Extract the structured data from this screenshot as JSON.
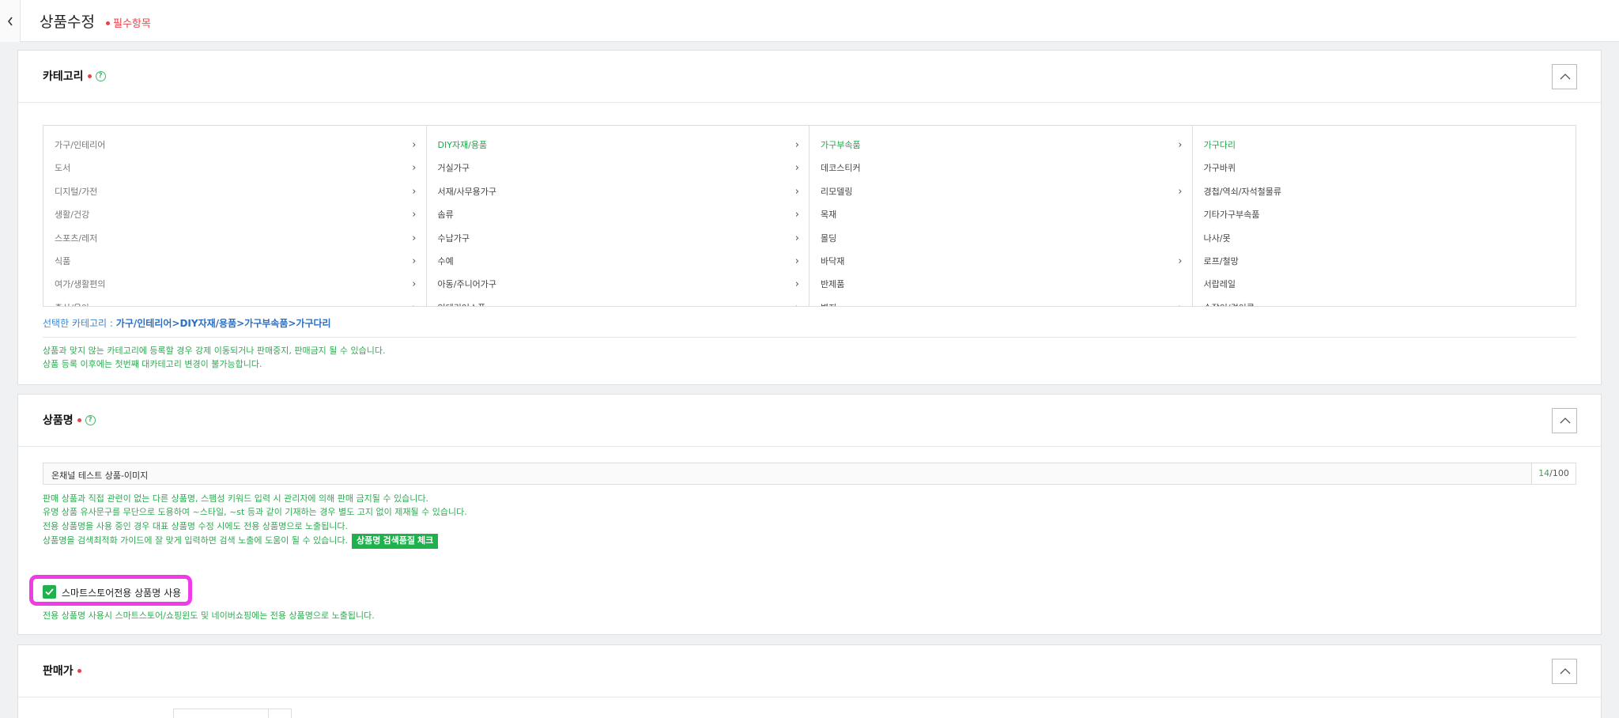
{
  "header": {
    "title": "상품수정",
    "required_note": "필수항목"
  },
  "category": {
    "title": "카테고리",
    "columns": [
      [
        {
          "label": "가구/인테리어",
          "arrow": true
        },
        {
          "label": "도서",
          "arrow": true
        },
        {
          "label": "디지털/가전",
          "arrow": true
        },
        {
          "label": "생활/건강",
          "arrow": true
        },
        {
          "label": "스포츠/레저",
          "arrow": true
        },
        {
          "label": "식품",
          "arrow": true
        },
        {
          "label": "여가/생활편의",
          "arrow": true
        },
        {
          "label": "출산/육아",
          "arrow": true
        }
      ],
      [
        {
          "label": "DIY자재/용품",
          "arrow": true,
          "selected": true
        },
        {
          "label": "거실가구",
          "arrow": true
        },
        {
          "label": "서재/사무용가구",
          "arrow": true
        },
        {
          "label": "솜류",
          "arrow": true
        },
        {
          "label": "수납가구",
          "arrow": true
        },
        {
          "label": "수예",
          "arrow": true
        },
        {
          "label": "아동/주니어가구",
          "arrow": true
        },
        {
          "label": "인테리어소품",
          "arrow": true
        }
      ],
      [
        {
          "label": "가구부속품",
          "arrow": true,
          "selected": true
        },
        {
          "label": "데코스티커",
          "arrow": false
        },
        {
          "label": "리모델링",
          "arrow": true
        },
        {
          "label": "목재",
          "arrow": false
        },
        {
          "label": "몰딩",
          "arrow": false
        },
        {
          "label": "바닥재",
          "arrow": true
        },
        {
          "label": "반제품",
          "arrow": false
        },
        {
          "label": "벽지",
          "arrow": true
        }
      ],
      [
        {
          "label": "가구다리",
          "arrow": false,
          "selected": true
        },
        {
          "label": "가구바퀴",
          "arrow": false
        },
        {
          "label": "경첩/역쇠/자석철물류",
          "arrow": false
        },
        {
          "label": "기타가구부속품",
          "arrow": false
        },
        {
          "label": "나사/못",
          "arrow": false
        },
        {
          "label": "로프/철망",
          "arrow": false
        },
        {
          "label": "서랍레일",
          "arrow": false
        },
        {
          "label": "손잡이/걸이류",
          "arrow": false
        }
      ]
    ],
    "selected_label": "선택한 카테고리 :",
    "selected_path": "가구/인테리어>DIY자재/용품>가구부속품>가구다리",
    "notices": [
      "상품과 맞지 않는 카테고리에 등록할 경우 강제 이동되거나 판매중지, 판매금지 될 수 있습니다.",
      "상품 등록 이후에는 첫번째 대카테고리 변경이 불가능합니다."
    ]
  },
  "product_name": {
    "title": "상품명",
    "value": "온채널 테스트 상품-이미지",
    "count_current": "14",
    "count_max": "/100",
    "notices": [
      "판매 상품과 직접 관련이 없는 다른 상품명, 스팸성 키워드 입력 시 관리자에 의해 판매 금지될 수 있습니다.",
      "유명 상품 유사문구를 무단으로 도용하여 ~스타일, ~st 등과 같이 기재하는 경우 별도 고지 없이 제재될 수 있습니다.",
      "전용 상품명을 사용 중인 경우 대표 상품명 수정 시에도 전용 상품명으로 노출됩니다.",
      "상품명을 검색최적화 가이드에 잘 맞게 입력하면 검색 노출에 도움이 될 수 있습니다."
    ],
    "seo_button": "상품명 검색품질 체크",
    "checkbox_label": "스마트스토어전용 상품명 사용",
    "checkbox_checked": true,
    "checkbox_notice": "전용 상품명 사용시 스마트스토어/쇼핑윈도 및 네이버쇼핑에는 전용 상품명으로 노출됩니다."
  },
  "price": {
    "title": "판매가"
  }
}
